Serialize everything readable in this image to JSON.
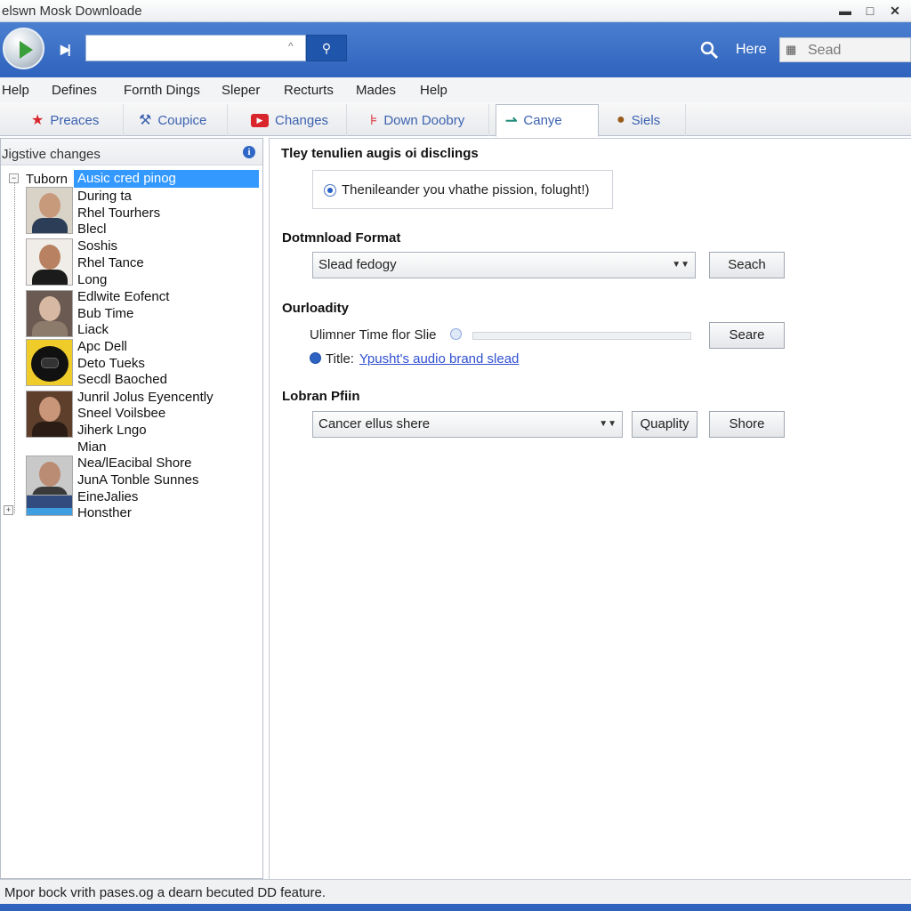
{
  "window": {
    "title": "elswn Mosk Downloade",
    "min_glyph": "▬",
    "max_glyph": "□",
    "close_glyph": "✕"
  },
  "toolbar": {
    "url_value": "",
    "go_glyph": "⚲",
    "here_label": "Here",
    "search_placeholder": "Sead",
    "accent": "#2f63bd"
  },
  "menu": [
    "Help",
    "Defines",
    "Fornth Dings",
    "Sleper",
    "Recturts",
    "Mades",
    "Help"
  ],
  "tabs": [
    {
      "label": "Preaces",
      "icon": "star-icon"
    },
    {
      "label": "Coupice",
      "icon": "toolbox-icon"
    },
    {
      "label": "Changes",
      "icon": "video-icon"
    },
    {
      "label": "Down Doobry",
      "icon": "ruler-icon"
    },
    {
      "label": "Canye",
      "icon": "play-arrow-icon"
    },
    {
      "label": "Siels",
      "icon": "user-icon"
    }
  ],
  "active_tab": "Canye",
  "left_panel": {
    "header": "Jigstive changes",
    "root_label": "Tuborn",
    "selected_item": "Ausic cred pinog",
    "items": [
      "During ta",
      "Rhel Tourhers",
      "Blecl",
      "Soshis",
      "Rhel Tance",
      "Long",
      "Edlwite Eofenct",
      "Bub Time",
      "Liack",
      "Apc Dell",
      "Deto Tueks",
      "Secdl Baoched",
      "Junril Jolus Eyencently",
      "Sneel Voilsbee",
      "Jiherk Lngo",
      "Mian",
      "Nea/lEacibal Shore",
      "JunA Tonble Sunnes",
      "EineJalies",
      "Honsther"
    ]
  },
  "right_panel": {
    "intro_title": "Tley tenulien augis oi disclings",
    "note": "Thenileander you vhathe pission, folught!)",
    "download_format_title": "Dotmnload Format",
    "format_value": "Slead fedogy",
    "format_button": "Seach",
    "quality_title": "Ourloadity",
    "quality_label": "Ulimner Time flor Slie",
    "quality_button": "Seare",
    "quality_level": 0,
    "title_prefix": "Title:",
    "title_link": "Ypusht's audio brand slead",
    "lobran_title": "Lobran Pfiin",
    "lobran_value": "Cancer ellus shere",
    "quality_btn2": "Quaplity",
    "share_button": "Shore"
  },
  "status": {
    "text": "Mpor bock vrith pases.og a dearn becuted DD feature."
  }
}
